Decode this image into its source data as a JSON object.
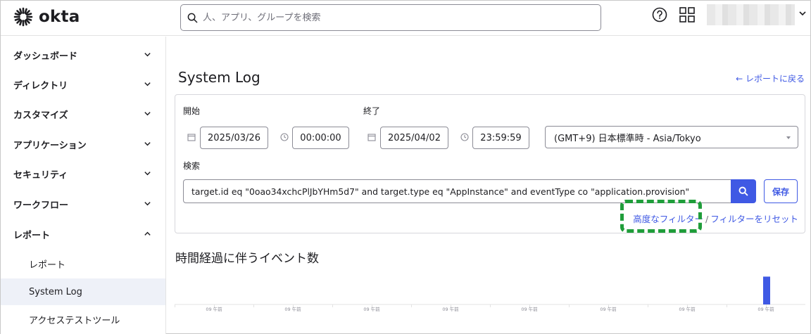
{
  "header": {
    "logo_text": "okta",
    "search_placeholder": "人、アプリ、グループを検索"
  },
  "sidebar": {
    "items": [
      {
        "label": "ダッシュボード",
        "expanded": false
      },
      {
        "label": "ディレクトリ",
        "expanded": false
      },
      {
        "label": "カスタマイズ",
        "expanded": false
      },
      {
        "label": "アプリケーション",
        "expanded": false
      },
      {
        "label": "セキュリティ",
        "expanded": false
      },
      {
        "label": "ワークフロー",
        "expanded": false
      },
      {
        "label": "レポート",
        "expanded": true
      }
    ],
    "sub_items": [
      {
        "label": "レポート",
        "active": false
      },
      {
        "label": "System Log",
        "active": true
      },
      {
        "label": "アクセステストツール",
        "active": false
      }
    ]
  },
  "main": {
    "title": "System Log",
    "back_link": "← レポートに戻る",
    "filters": {
      "start_label": "開始",
      "end_label": "終了",
      "start_date": "2025/03/26",
      "start_time": "00:00:00",
      "end_date": "2025/04/02",
      "end_time": "23:59:59",
      "timezone": "(GMT+9) 日本標準時 - Asia/Tokyo",
      "search_label": "検索",
      "query": "target.id eq \"0oao34xchcPlJbYHm5d7\" and target.type eq \"AppInstance\" and eventType co \"application.provision\"",
      "save_label": "保存",
      "advanced_filter": "高度なフィルター",
      "separator": "/",
      "reset_filter": "フィルターをリセット"
    },
    "chart_title": "時間経過に伴うイベント数"
  },
  "colors": {
    "accent": "#3f59e4",
    "highlight": "#1f9d3a"
  },
  "chart_data": {
    "type": "bar",
    "title": "時間経過に伴うイベント数",
    "categories": [
      "09 午前",
      "09 午前",
      "09 午前",
      "09 午前",
      "09 午前",
      "09 午前",
      "09 午前",
      "09 午前"
    ],
    "values": [
      0,
      0,
      0,
      0,
      0,
      0,
      0,
      1
    ],
    "grid": true
  }
}
